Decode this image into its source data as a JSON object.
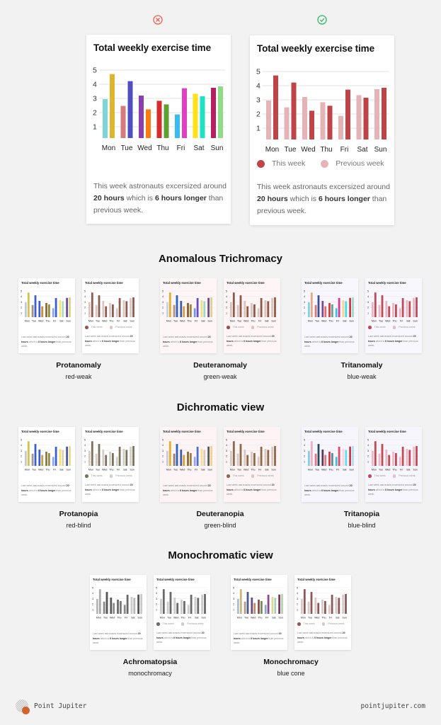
{
  "chart_data": {
    "type": "bar",
    "title": "Total weekly exercise time",
    "categories": [
      "Mon",
      "Tue",
      "Wed",
      "Thu",
      "Fri",
      "Sat",
      "Sun"
    ],
    "series": [
      {
        "name": "Previous week",
        "values": [
          2.95,
          2.47,
          3.2,
          2.83,
          1.87,
          3.33,
          3.75
        ]
      },
      {
        "name": "This week",
        "values": [
          4.72,
          4.22,
          2.23,
          2.58,
          3.72,
          3.15,
          3.85
        ]
      }
    ],
    "yticks": [
      1,
      2,
      3,
      4,
      5
    ],
    "ylim": [
      0,
      5
    ],
    "xlabel": "",
    "ylabel": "",
    "grid": true
  },
  "bad_example": {
    "status_icon": "x-circle-icon",
    "status_color": "#e8604f",
    "title": "Total weekly exercise time",
    "bar_colors": [
      [
        "#7fd6d6",
        "#dcb72e"
      ],
      [
        "#d67b7b",
        "#4f4fc2"
      ],
      [
        "#8a3fb0",
        "#ff7a10"
      ],
      [
        "#d62c2c",
        "#5fa032"
      ],
      [
        "#3bbcf0",
        "#e03fc4"
      ],
      [
        "#ffe11a",
        "#1de3c4"
      ],
      [
        "#b81f63",
        "#8ddb84"
      ]
    ],
    "description": {
      "part1": "This week astronauts excersized around ",
      "bold1": "20 hours",
      "part2": " which is ",
      "bold2": "6 hours longer",
      "part3": " than previous week."
    }
  },
  "good_example": {
    "status_icon": "check-circle-icon",
    "status_color": "#2fb866",
    "title": "Total weekly exercise time",
    "this_week_color": "#bf4448",
    "previous_week_color": "#e6b4b6",
    "legend": {
      "this_week": "This week",
      "previous_week": "Previous week"
    },
    "description": {
      "part1": "This week astronauts excersized around ",
      "bold1": "20 hours",
      "part2": " which is ",
      "bold2": "6 hours longer",
      "part3": " than previous week."
    }
  },
  "mini_text": {
    "title": "Total weekly exercise time",
    "legend_this": "This week",
    "legend_prev": "Previous week",
    "desc_part1": "Last week astronauts excersized around ",
    "desc_bold1": "20 hours",
    "desc_part2": " which is ",
    "desc_bold2": "6 hours longer",
    "desc_part3": " than previous week."
  },
  "sections": [
    {
      "title": "Anomalous Trichromacy",
      "conditions": [
        {
          "name": "Protanomaly",
          "subtitle": "red-weak",
          "multi": [
            [
              "#b9cbe0",
              "#d9c04a"
            ],
            [
              "#a89080",
              "#3f5fcf"
            ],
            [
              "#3f5fcf",
              "#c8902e"
            ],
            [
              "#8a6a30",
              "#9a8a3a"
            ],
            [
              "#8aa8f0",
              "#3f5fcf"
            ],
            [
              "#ffe66a",
              "#a8dcc8"
            ],
            [
              "#6a4aa0",
              "#dcd08a"
            ]
          ],
          "this": "#8b5e53",
          "prev": "#dcc6c2",
          "tint": "#ffffff"
        },
        {
          "name": "Deuteranomaly",
          "subtitle": "green-weak",
          "multi": [
            [
              "#c6d6e6",
              "#e0b030"
            ],
            [
              "#b89080",
              "#3060c0"
            ],
            [
              "#3a5ab8",
              "#d8a040"
            ],
            [
              "#8a5a30",
              "#a08a40"
            ],
            [
              "#7098e0",
              "#6a4ac0"
            ],
            [
              "#f0e080",
              "#a0d8c8"
            ],
            [
              "#6a4a8a",
              "#dcd090"
            ]
          ],
          "this": "#8e5a48",
          "prev": "#dcc4bc",
          "tint": "#fdf5f6"
        },
        {
          "name": "Tritanomaly",
          "subtitle": "blue-weak",
          "multi": [
            [
              "#7cd6e0",
              "#e8a888"
            ],
            [
              "#d67a7a",
              "#3a4f9a"
            ],
            [
              "#7a4a9a",
              "#ef6a60"
            ],
            [
              "#d63a3a",
              "#6aa090"
            ],
            [
              "#40c0e8",
              "#d63a8a"
            ],
            [
              "#ffd08a",
              "#40e0e8"
            ],
            [
              "#c83a4a",
              "#a0dcc8"
            ]
          ],
          "this": "#bf4a58",
          "prev": "#eab8c0",
          "tint": "#f7f7fd"
        }
      ]
    },
    {
      "title": "Dichromatic view",
      "conditions": [
        {
          "name": "Protanopia",
          "subtitle": "red-blind",
          "multi": [
            [
              "#c8c8cc",
              "#d6bf50"
            ],
            [
              "#a09a90",
              "#3a60d0"
            ],
            [
              "#3a60d0",
              "#c8a040"
            ],
            [
              "#8a7a40",
              "#9a8a50"
            ],
            [
              "#90a8f0",
              "#3a60d0"
            ],
            [
              "#f8e070",
              "#d8d2b0"
            ],
            [
              "#4a5aa0",
              "#e8d890"
            ]
          ],
          "this": "#7a725e",
          "prev": "#d2cec6",
          "tint": "#ffffff"
        },
        {
          "name": "Deuteranopia",
          "subtitle": "green-blind",
          "multi": [
            [
              "#d0c8e0",
              "#e0b030"
            ],
            [
              "#9a8070",
              "#3060c0"
            ],
            [
              "#3a5ab8",
              "#d8a030"
            ],
            [
              "#8a6a30",
              "#a0803a"
            ],
            [
              "#90a8e8",
              "#5070c8"
            ],
            [
              "#f8e090",
              "#d8cac0"
            ],
            [
              "#5a5a5a",
              "#f0d090"
            ]
          ],
          "this": "#8a6a4a",
          "prev": "#dcc8c0",
          "tint": "#fdf4f6"
        },
        {
          "name": "Tritanopia",
          "subtitle": "blue-blind",
          "multi": [
            [
              "#80d0e0",
              "#f0b0c0"
            ],
            [
              "#e07a80",
              "#2a4a60"
            ],
            [
              "#5a3a5a",
              "#e07a80"
            ],
            [
              "#d63a40",
              "#5a8aa0"
            ],
            [
              "#40c0e0",
              "#e04a60"
            ],
            [
              "#ffd0e0",
              "#60e0f0"
            ],
            [
              "#c83a48",
              "#b0e0f0"
            ]
          ],
          "this": "#c04a55",
          "prev": "#ecbcc6",
          "tint": "#f6f6fc"
        }
      ]
    },
    {
      "title": "Monochromatic view",
      "conditions": [
        {
          "name": "Achromatopsia",
          "subtitle": "monochromacy",
          "multi": [
            [
              "#b8b8b8",
              "#aaaaaa"
            ],
            [
              "#8a8a8a",
              "#555555"
            ],
            [
              "#5a5a5a",
              "#8a8a8a"
            ],
            [
              "#6a6a6a",
              "#7a7a7a"
            ],
            [
              "#8a8a8a",
              "#6a6a6a"
            ],
            [
              "#cccccc",
              "#b8b8b8"
            ],
            [
              "#555555",
              "#c8c8c8"
            ]
          ],
          "this": "#6a6a6a",
          "prev": "#cccccc",
          "tint": "#ffffff"
        },
        {
          "name": "Monochromacy",
          "subtitle": "blue cone",
          "multi": [
            [
              "#a8c0d0",
              "#c8b87a"
            ],
            [
              "#b89a8a",
              "#4a5a8a"
            ],
            [
              "#6a4a7a",
              "#b89070"
            ],
            [
              "#8a4a4a",
              "#7a8a5a"
            ],
            [
              "#8aa8c8",
              "#8a4a8a"
            ],
            [
              "#e0d890",
              "#a8d0c0"
            ],
            [
              "#7a3a5a",
              "#b8d0b0"
            ]
          ],
          "this": "#8a5a5a",
          "prev": "#d8c8c8",
          "tint": "#ffffff"
        }
      ]
    }
  ],
  "footer": {
    "brand": "Point Jupiter",
    "url": "pointjupiter.com",
    "logo_icon": "jupiter-planet-icon",
    "logo_accent": "#d4622b"
  }
}
